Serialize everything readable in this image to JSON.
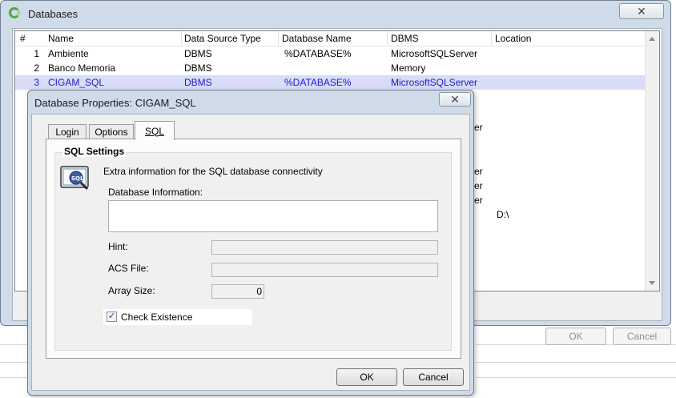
{
  "databases_window": {
    "title": "Databases",
    "close_glyph": "✕",
    "columns": [
      "#",
      "Name",
      "Data Source Type",
      "Database Name",
      "DBMS",
      "Location"
    ],
    "rows": [
      {
        "num": "1",
        "name": "Ambiente",
        "source": "DBMS",
        "dbname": "%DATABASE%",
        "dbms": "MicrosoftSQLServer",
        "location": ""
      },
      {
        "num": "2",
        "name": "Banco Memoria",
        "source": "DBMS",
        "dbname": "",
        "dbms": "Memory",
        "location": ""
      },
      {
        "num": "3",
        "name": "CIGAM_SQL",
        "source": "DBMS",
        "dbname": "%DATABASE%",
        "dbms": "MicrosoftSQLServer",
        "location": ""
      }
    ],
    "partial_dbms_suffixes": [
      "er",
      "er",
      "er",
      "er"
    ],
    "partial_location": "D:\\",
    "ok_label": "OK",
    "cancel_label": "Cancel"
  },
  "props_dialog": {
    "title": "Database Properties: CIGAM_SQL",
    "close_glyph": "✕",
    "tabs": {
      "login": "Login",
      "options": "Options",
      "sql": "SQL"
    },
    "group_title": "SQL Settings",
    "description": "Extra information for the SQL database connectivity",
    "db_info_label": "Database Information:",
    "hint_label": "Hint:",
    "acs_label": "ACS File:",
    "array_label": "Array Size:",
    "array_value": "0",
    "check_label": "Check Existence",
    "check_glyph": "✓",
    "ok_label": "OK",
    "cancel_label": "Cancel"
  },
  "colors": {
    "selection_bg": "#d8dcf7",
    "selection_text": "#1a1ad0",
    "chrome": "#cfdbe9"
  },
  "icons": {
    "app": "app-icon",
    "sql": "sql-database-icon"
  }
}
